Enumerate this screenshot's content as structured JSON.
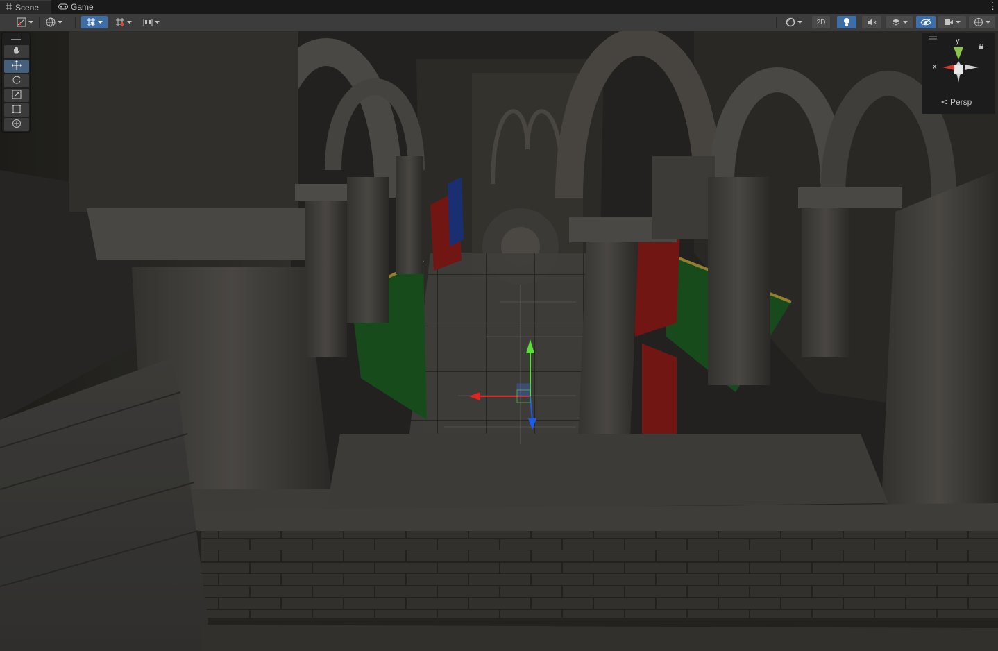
{
  "tabs": [
    {
      "label": "Scene",
      "icon": "grid-icon",
      "active": true
    },
    {
      "label": "Game",
      "icon": "gamepad-icon",
      "active": false
    }
  ],
  "toolbar": {
    "draw_mode_icon": "shading-mode-icon",
    "global_icon": "globe-icon",
    "grid_snap_icon": "grid-snap-icon",
    "increment_snap_icon": "increment-snap-icon",
    "button_2d": "2D",
    "lighting_icon": "lightbulb-icon",
    "audio_icon": "audio-mute-icon",
    "effects_icon": "effects-icon",
    "visibility_icon": "hidden-objects-icon",
    "camera_icon": "camera-icon",
    "gizmos_icon": "gizmos-icon",
    "accent_color": "#3d6ea8"
  },
  "tools": [
    {
      "name": "hand-tool",
      "icon": "hand-icon",
      "selected": false
    },
    {
      "name": "move-tool",
      "icon": "move-icon",
      "selected": true
    },
    {
      "name": "rotate-tool",
      "icon": "rotate-icon",
      "selected": false
    },
    {
      "name": "scale-tool",
      "icon": "scale-icon",
      "selected": false
    },
    {
      "name": "rect-tool",
      "icon": "rect-icon",
      "selected": false
    },
    {
      "name": "transform-tool",
      "icon": "transform-icon",
      "selected": false
    }
  ],
  "orientation_gizmo": {
    "y_label": "y",
    "x_label": "x",
    "projection_label": "Persp",
    "x_color": "#d0392b",
    "y_color": "#8bc34a",
    "z_color": "#3a6fd8"
  },
  "transform_handle": {
    "x_color": "#e0261f",
    "y_color": "#58e038",
    "z_color": "#1b5cf0"
  }
}
